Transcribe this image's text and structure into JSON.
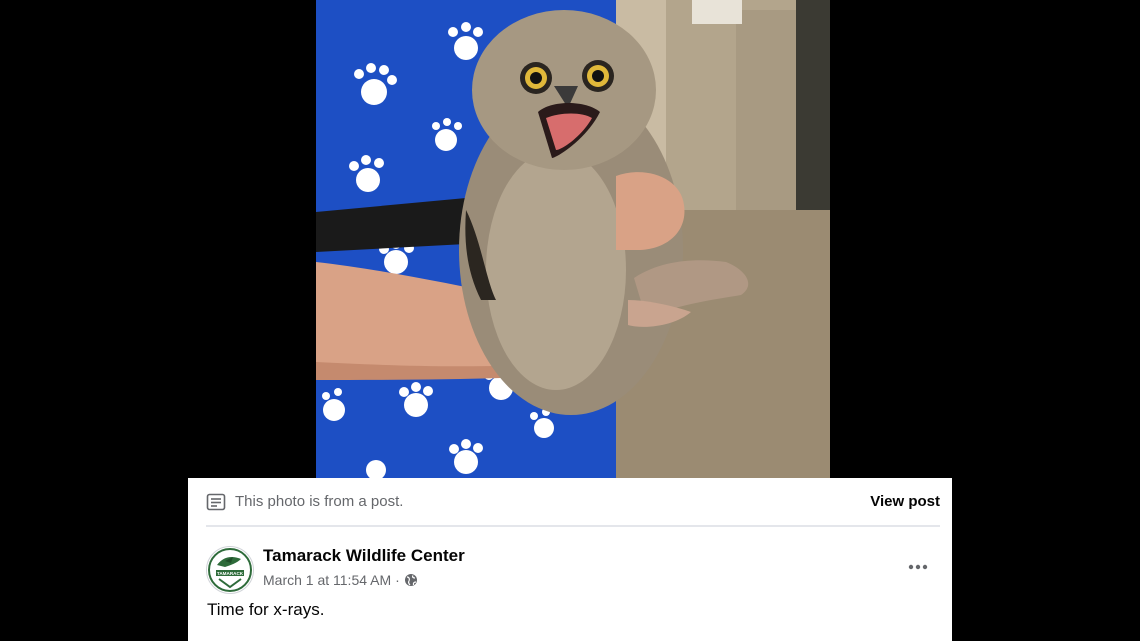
{
  "banner": {
    "text": "This photo is from a post.",
    "view_post_label": "View post"
  },
  "post": {
    "author": "Tamarack Wildlife Center",
    "avatar_text": "TAMARACK",
    "date": "March 1 at 11:54 AM",
    "separator": "·",
    "privacy_icon": "globe-icon",
    "caption": "Time for x-rays."
  },
  "icons": {
    "banner": "document-icon",
    "more": "more-options-icon"
  },
  "colors": {
    "page_background": "#000000",
    "card_background": "#ffffff",
    "secondary_text": "#65676b",
    "primary_text": "#050505"
  }
}
